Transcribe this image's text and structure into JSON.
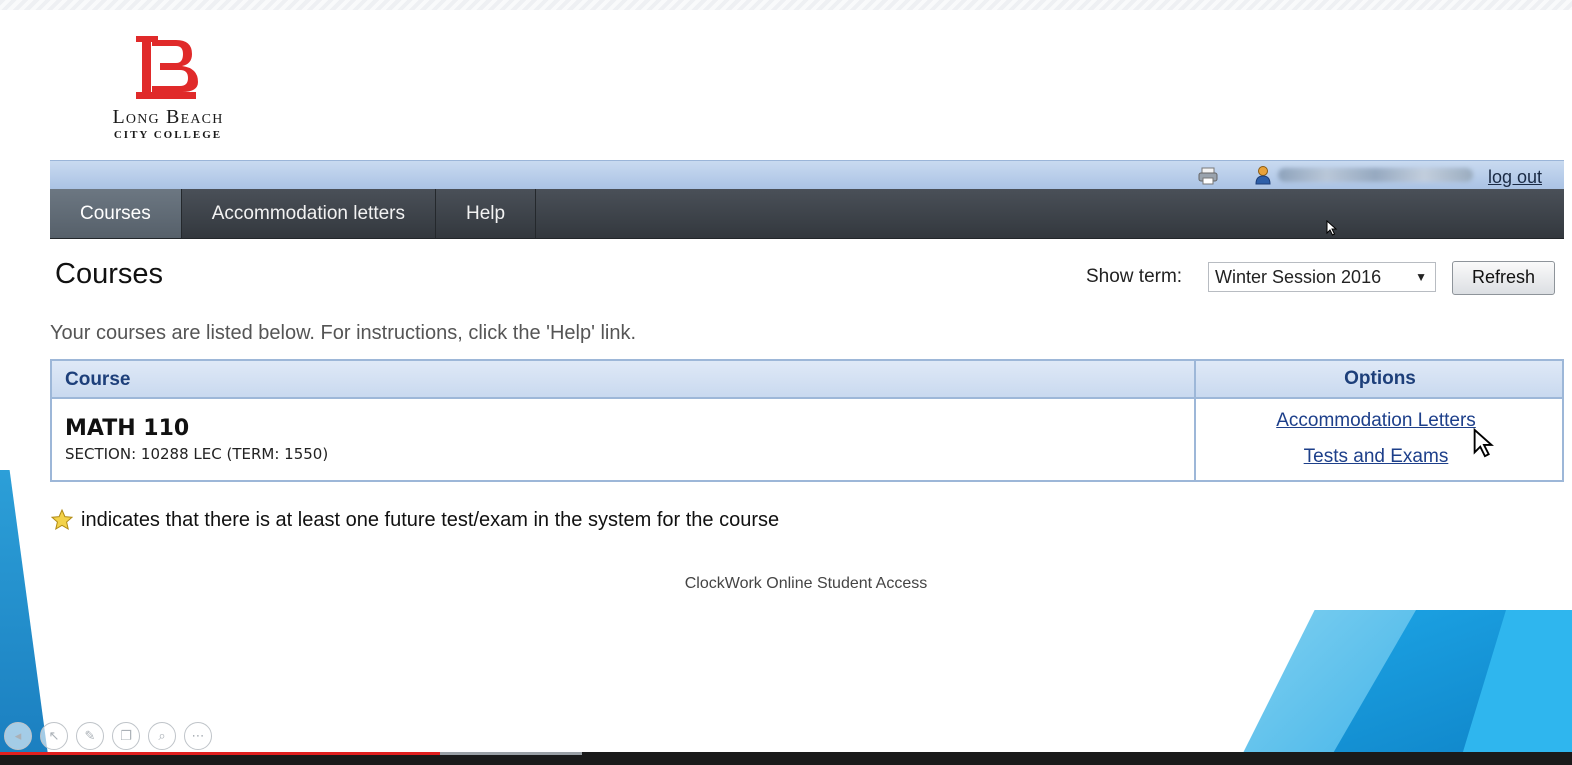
{
  "logo": {
    "line1": "Long Beach",
    "line2": "CITY COLLEGE",
    "color": "#e02a2a"
  },
  "util_bar": {
    "logout_label": "log out"
  },
  "nav": {
    "items": [
      {
        "label": "Courses",
        "active": true
      },
      {
        "label": "Accommodation letters",
        "active": false
      },
      {
        "label": "Help",
        "active": false
      }
    ]
  },
  "page": {
    "title": "Courses",
    "term_label": "Show term:",
    "term_selected": "Winter Session 2016",
    "refresh_label": "Refresh",
    "intro": "Your courses are listed below. For instructions, click the 'Help' link."
  },
  "table": {
    "headers": {
      "course": "Course",
      "options": "Options"
    },
    "rows": [
      {
        "code": "MATH 110",
        "section": "SECTION: 10288 LEC (TERM: 1550)",
        "options": [
          "Accommodation Letters",
          "Tests and Exams"
        ]
      }
    ]
  },
  "legend": {
    "text": "indicates that there is at least one future test/exam in the system for the course"
  },
  "footer": {
    "text": "ClockWork Online Student Access"
  },
  "player": {
    "progress_percent": 28,
    "buffer_percent": 37,
    "controls": [
      "prev-icon",
      "pointer-icon",
      "pen-icon",
      "copy-icon",
      "zoom-icon",
      "more-icon"
    ]
  },
  "colors": {
    "nav_bg": "#3f454c",
    "nav_active": "#626c76",
    "table_border": "#9db7d8",
    "header_text": "#1d3f7a",
    "link": "#1d3f8a",
    "accent_blue": "#1ca3e4"
  }
}
